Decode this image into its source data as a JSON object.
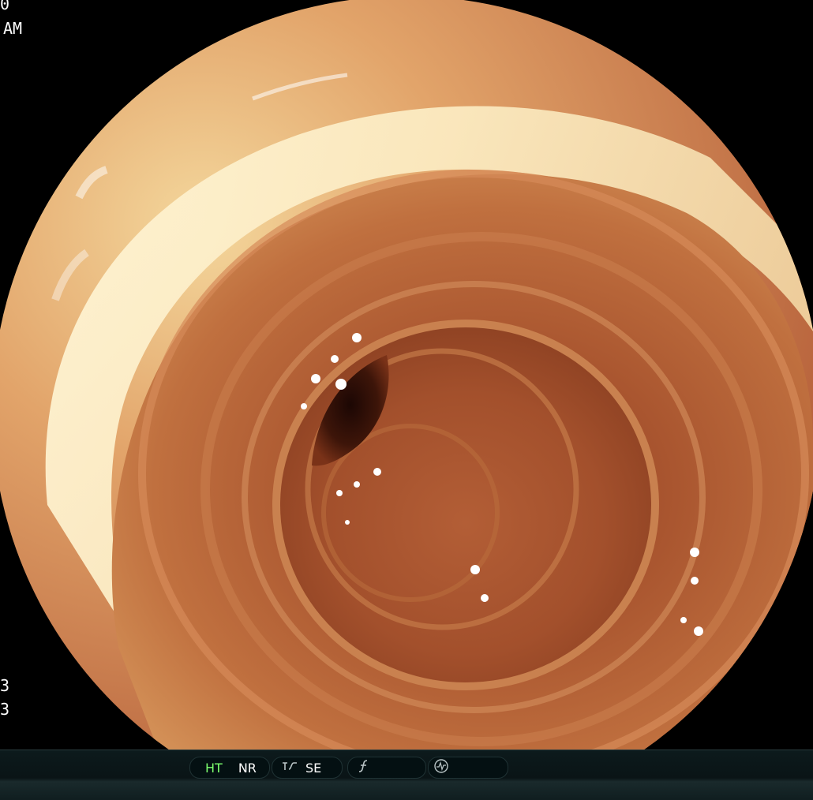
{
  "overlay": {
    "top_left_partial_1": "0",
    "top_left_partial_2": "AM",
    "bottom_left_partial_1": "3",
    "bottom_left_partial_2": "3"
  },
  "status_bar": {
    "ht_label": "HT",
    "nr_label": "NR",
    "se_label": "SE"
  },
  "icons": {
    "enhance": "enhance-curve-icon",
    "function": "function-f-icon",
    "waveform": "waveform-circle-icon"
  },
  "colors": {
    "mucosa_base": "#b8633c",
    "highlight": "#f7f0c8",
    "lumen_dark": "#2a0d06",
    "ht_active": "#7dff6e"
  }
}
